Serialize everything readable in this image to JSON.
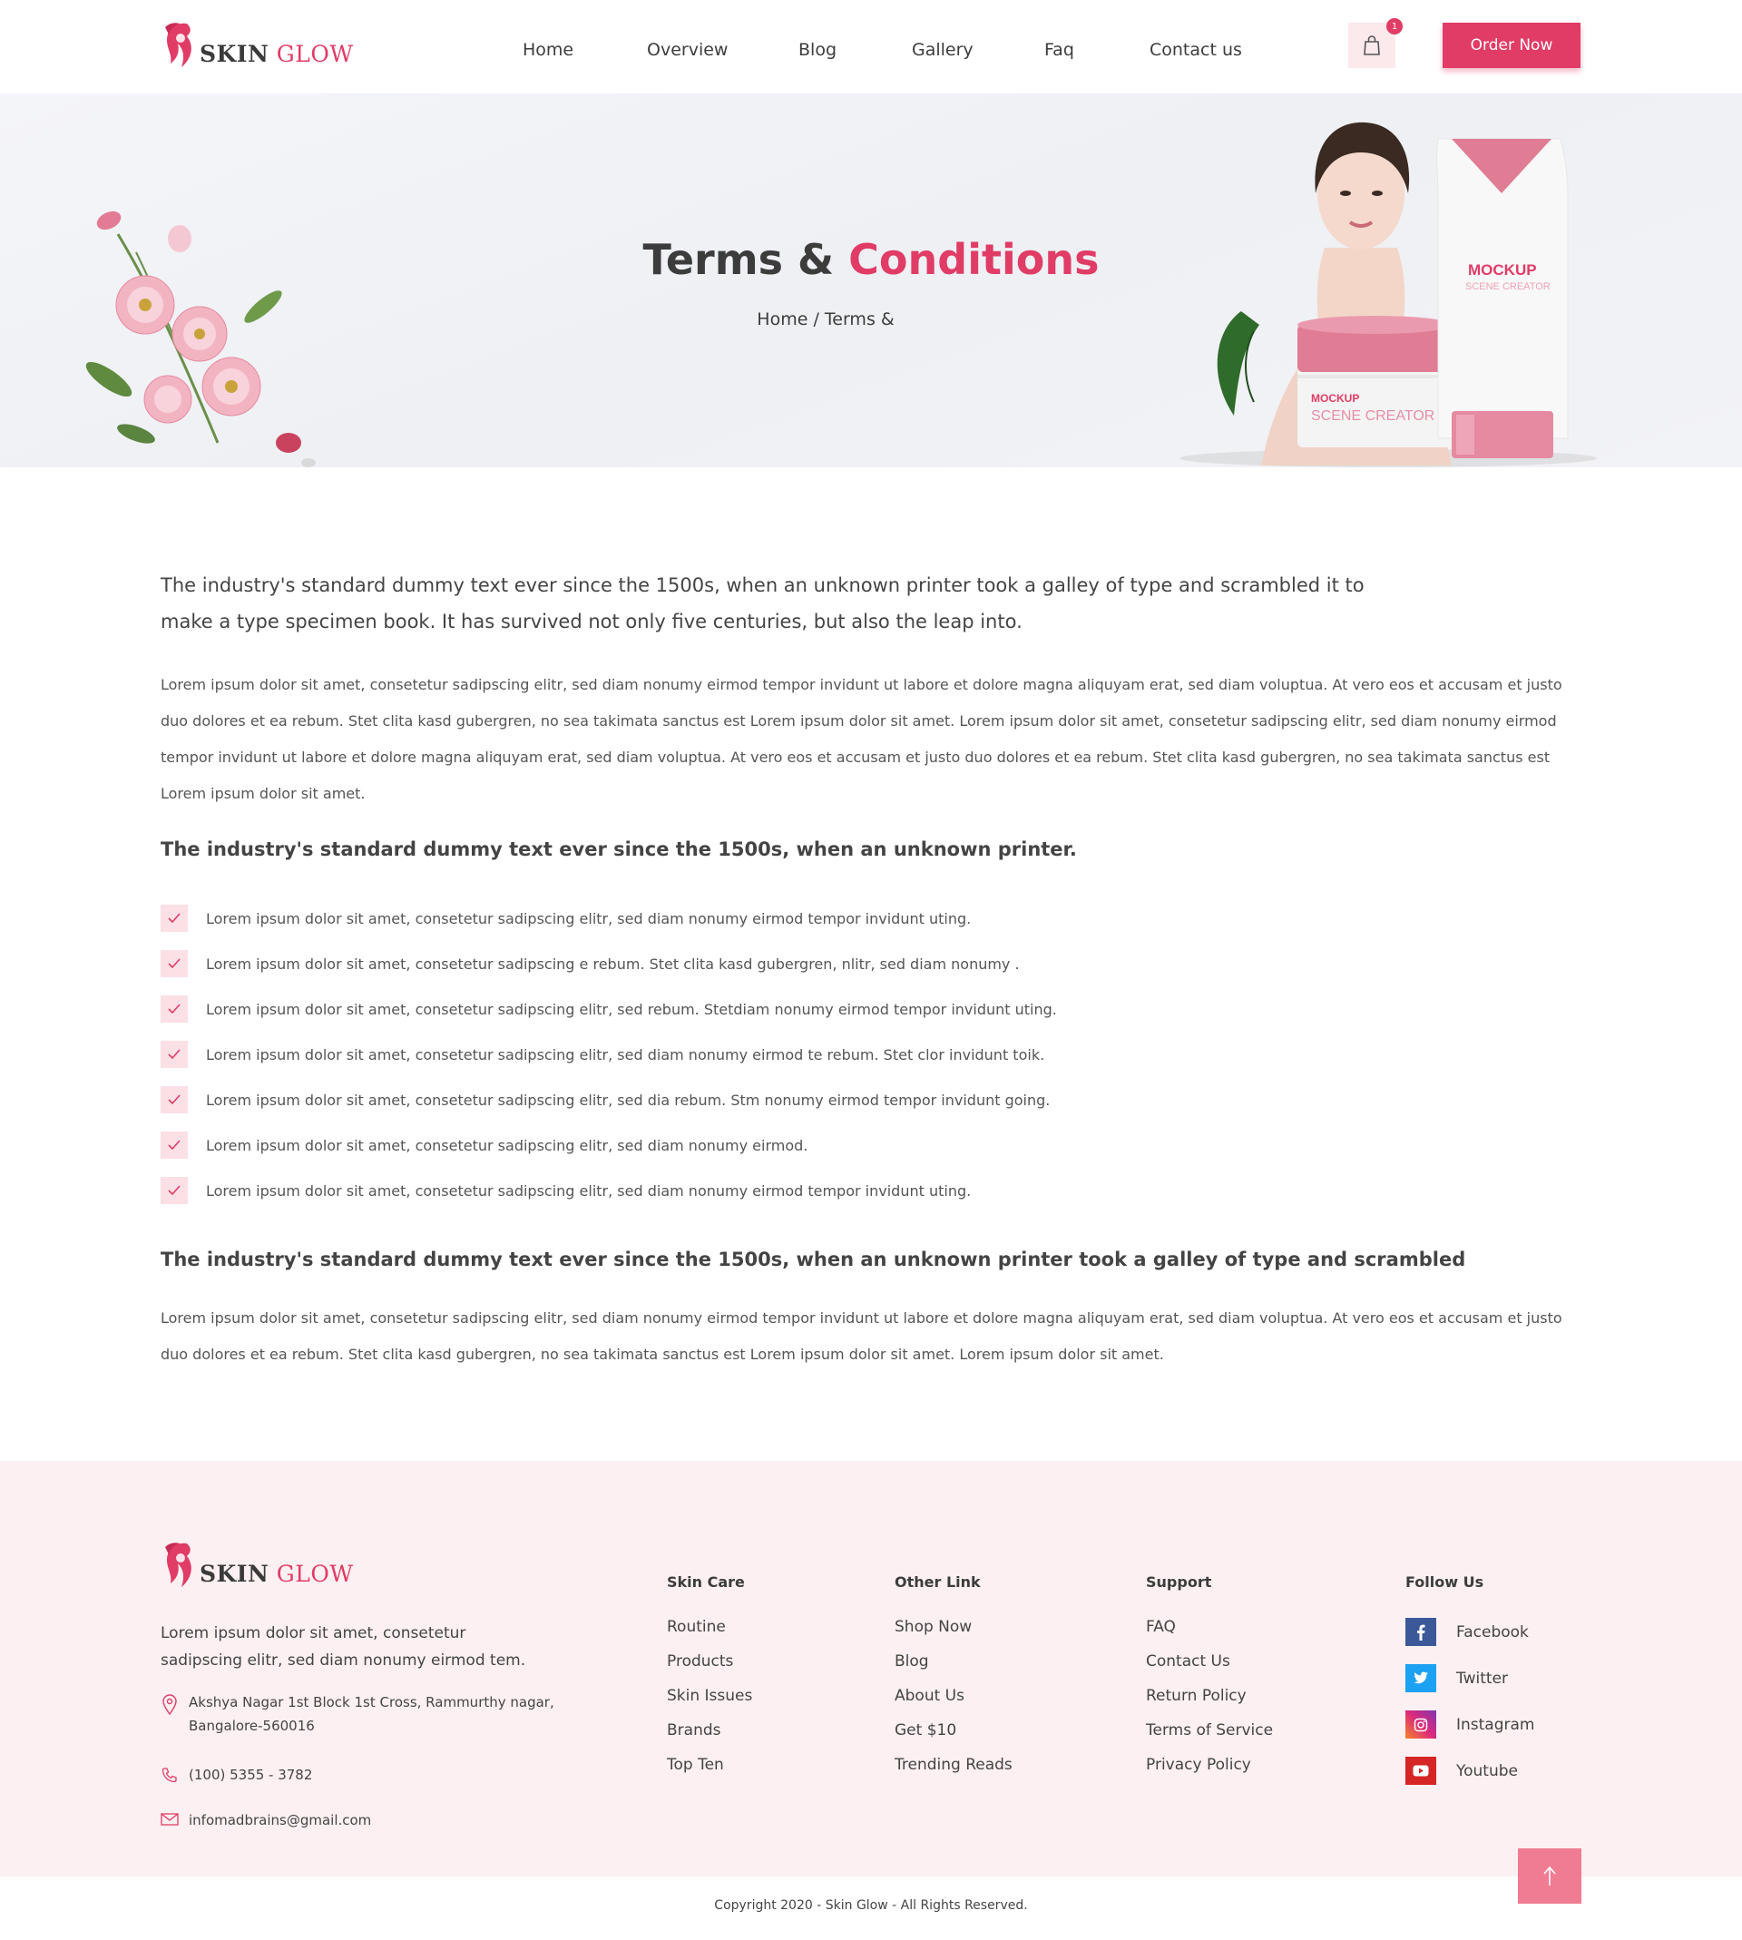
{
  "brand": {
    "name_part1": "SKIN",
    "name_part2": "GLOW",
    "accent": "#e03c66"
  },
  "nav": {
    "items": [
      "Home",
      "Overview",
      "Blog",
      "Gallery",
      "Faq",
      "Contact us"
    ],
    "cart_count": "1",
    "order_label": "Order Now"
  },
  "hero": {
    "title_part1": "Terms &",
    "title_part2": "Conditions",
    "breadcrumb_home": "Home",
    "breadcrumb_sep": "/",
    "breadcrumb_current": "Terms &"
  },
  "content": {
    "lead": "The industry's standard dummy text ever since the 1500s, when an unknown printer took a galley of type and scrambled it to make a type specimen book. It has survived not only five centuries, but also the leap into.",
    "para1": "Lorem ipsum dolor sit amet, consetetur sadipscing elitr, sed diam nonumy eirmod tempor invidunt ut labore et dolore magna aliquyam erat, sed diam voluptua. At vero eos et accusam et justo duo dolores et ea rebum. Stet clita kasd gubergren, no sea takimata sanctus est Lorem ipsum dolor sit amet. Lorem ipsum dolor sit amet, consetetur sadipscing elitr, sed diam nonumy eirmod tempor invidunt ut labore et dolore magna aliquyam erat, sed diam voluptua. At vero eos et accusam et justo duo dolores et ea rebum. Stet clita kasd gubergren, no sea takimata sanctus est Lorem ipsum dolor sit amet.",
    "subhead1": "The industry's standard dummy text ever since the 1500s, when an unknown printer.",
    "checklist": [
      "Lorem ipsum dolor sit amet, consetetur sadipscing elitr, sed diam nonumy eirmod tempor invidunt uting.",
      "Lorem ipsum dolor sit amet, consetetur sadipscing e rebum. Stet clita kasd gubergren, nlitr, sed diam nonumy .",
      "Lorem ipsum dolor sit amet, consetetur sadipscing elitr, sed  rebum. Stetdiam nonumy eirmod tempor invidunt uting.",
      "Lorem ipsum dolor sit amet, consetetur sadipscing elitr, sed diam nonumy eirmod te rebum. Stet clor invidunt toik.",
      "Lorem ipsum dolor sit amet, consetetur sadipscing elitr, sed dia rebum. Stm nonumy eirmod tempor invidunt going.",
      "Lorem ipsum dolor sit amet, consetetur sadipscing elitr, sed diam nonumy eirmod.",
      "Lorem ipsum dolor sit amet, consetetur sadipscing elitr, sed diam nonumy eirmod tempor invidunt uting."
    ],
    "subhead2": "The industry's standard dummy text ever since the 1500s, when an unknown printer took a galley of type and scrambled",
    "para2": "Lorem ipsum dolor sit amet, consetetur sadipscing elitr, sed diam nonumy eirmod tempor invidunt ut labore et dolore magna aliquyam erat, sed diam voluptua. At vero eos et accusam et justo duo dolores et ea rebum. Stet clita kasd gubergren, no sea takimata sanctus est Lorem ipsum dolor sit amet. Lorem ipsum dolor sit amet."
  },
  "footer": {
    "description": "Lorem ipsum dolor sit amet, consetetur sadipscing elitr, sed diam nonumy eirmod tem.",
    "address_line1": "Akshya Nagar 1st Block 1st Cross, Rammurthy nagar,",
    "address_line2": "Bangalore-560016",
    "phone": "(100) 5355 - 3782",
    "email": "infomadbrains@gmail.com",
    "col_skin_care": {
      "title": "Skin Care",
      "links": [
        "Routine",
        "Products",
        "Skin Issues",
        "Brands",
        "Top Ten"
      ]
    },
    "col_other": {
      "title": "Other Link",
      "links": [
        "Shop Now",
        "Blog",
        "About Us",
        "Get $10",
        "Trending Reads"
      ]
    },
    "col_support": {
      "title": "Support",
      "links": [
        "FAQ",
        "Contact Us",
        "Return Policy",
        "Terms of Service",
        "Privacy Policy"
      ]
    },
    "col_follow": {
      "title": "Follow Us",
      "links": [
        {
          "label": "Facebook",
          "icon": "facebook-icon",
          "color": "#3b5998"
        },
        {
          "label": "Twitter",
          "icon": "twitter-icon",
          "color": "#1da1f2"
        },
        {
          "label": "Instagram",
          "icon": "instagram-icon",
          "color": "#e1306c"
        },
        {
          "label": "Youtube",
          "icon": "youtube-icon",
          "color": "#d62525"
        }
      ]
    },
    "copyright": "Copyright 2020 - Skin Glow - All Rights Reserved."
  }
}
